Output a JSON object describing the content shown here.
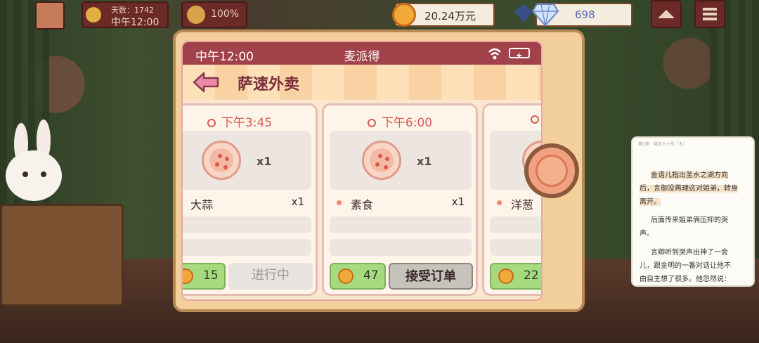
{
  "hud": {
    "days": "天数：1742",
    "clock": "中午12:00",
    "mood": "100%",
    "money": "20.24万元",
    "gems": "698"
  },
  "phone": {
    "status_time": "中午12:00",
    "app_name": "麦派得",
    "screen_title": "萨速外卖",
    "orders": [
      {
        "due": "下午3:45",
        "qty": "x1",
        "item": "大蒜",
        "item_qty": "x1",
        "reward": "15",
        "action": "进行中"
      },
      {
        "due": "下午6:00",
        "qty": "x1",
        "item": "素食",
        "item_qty": "x1",
        "reward": "47",
        "action": "接受订单"
      },
      {
        "due": "",
        "qty": "",
        "item": "洋葱",
        "item_qty": "",
        "reward": "22",
        "action": ""
      }
    ]
  },
  "novel": {
    "header": "第1章　目页六十号（五）",
    "p1_a": "金语儿指出圣水之湖方向",
    "p1_b": "后，言御没再理这对姐弟，转身",
    "p1_c": "离开。",
    "p2_a": "后面传来姐弟俩压抑的哭",
    "p2_b": "声。",
    "p3_a": "言卿听到哭声出神了一会",
    "p3_b": "儿，跟金明的一番对话让他不",
    "p3_c": "由自主想了很多。他忽然说："
  },
  "colors": {
    "status_bar": "#a1414a",
    "due_text": "#d85c4e",
    "reward_green": "#a6da7e",
    "phone_frame": "#f3cf9c"
  },
  "icons": [
    "avatar",
    "sun-icon",
    "smile-icon",
    "coin-icon",
    "diamond-icon",
    "chevron-up-icon",
    "menu-icon",
    "wifi-icon",
    "battery-icon",
    "back-arrow-icon",
    "clock-icon",
    "pizza-dish-icon",
    "home-button"
  ]
}
